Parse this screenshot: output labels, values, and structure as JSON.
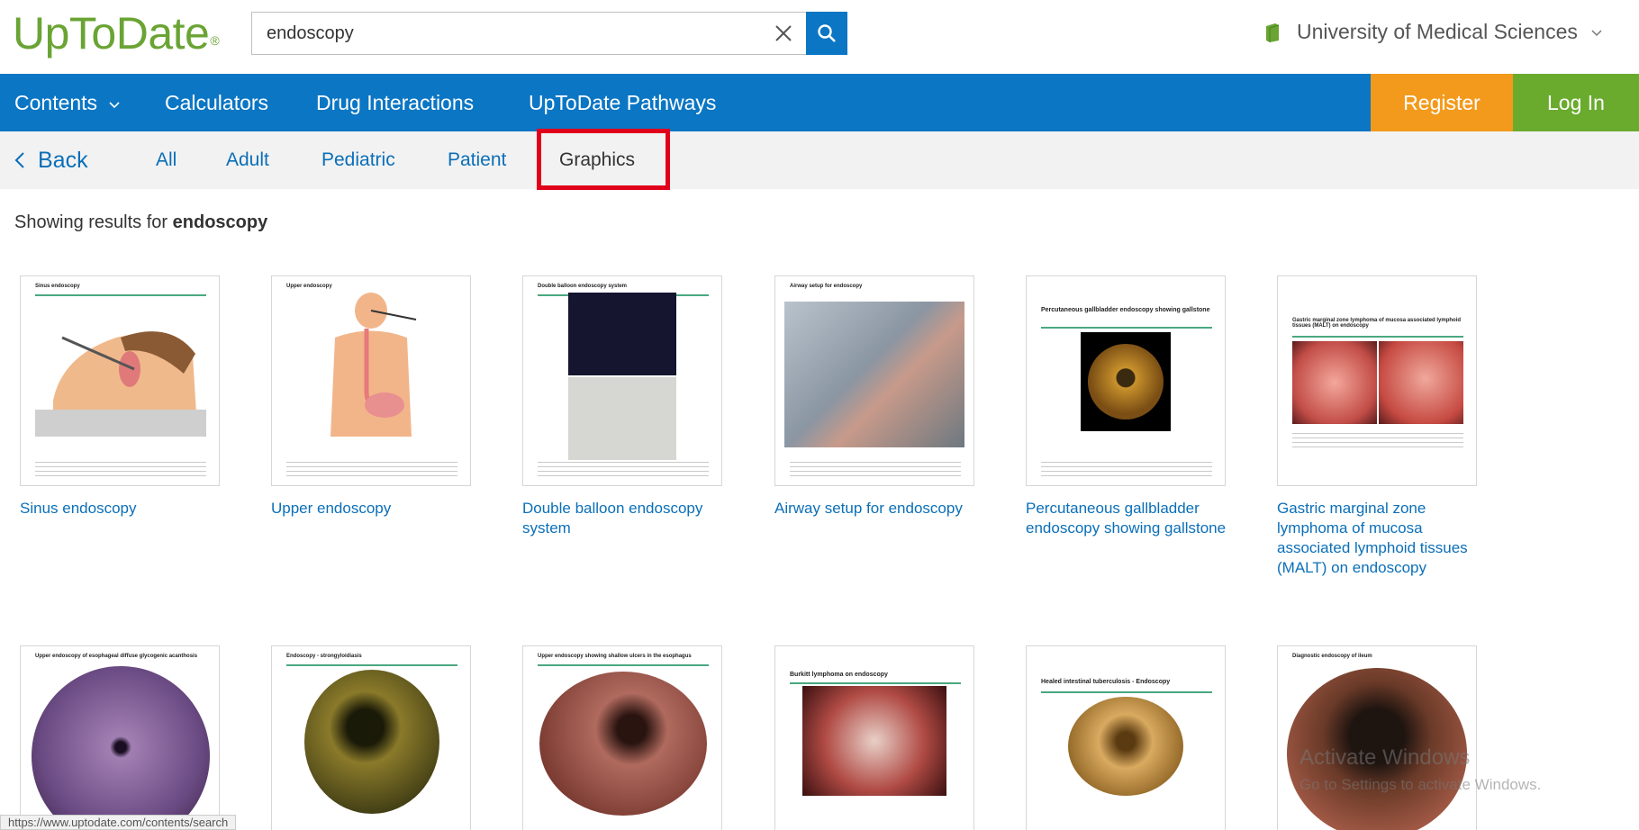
{
  "header": {
    "logo": "UpToDate",
    "logo_mark": "®",
    "search_value": "endoscopy",
    "institution": "University of Medical Sciences"
  },
  "nav": {
    "contents": "Contents",
    "calculators": "Calculators",
    "drug_interactions": "Drug Interactions",
    "pathways": "UpToDate Pathways",
    "register": "Register",
    "login": "Log In"
  },
  "subnav": {
    "back": "Back",
    "tabs": [
      "All",
      "Adult",
      "Pediatric",
      "Patient",
      "Graphics"
    ],
    "active_tab": "Graphics"
  },
  "results": {
    "prefix": "Showing results for",
    "query": "endoscopy",
    "row1": [
      {
        "thumb_title": "Sinus endoscopy",
        "label": "Sinus endoscopy"
      },
      {
        "thumb_title": "Upper endoscopy",
        "label": "Upper endoscopy"
      },
      {
        "thumb_title": "Double balloon endoscopy system",
        "label": "Double balloon endoscopy system"
      },
      {
        "thumb_title": "Airway setup for endoscopy",
        "label": "Airway setup for endoscopy"
      },
      {
        "thumb_title": "Percutaneous gallbladder endoscopy showing gallstone",
        "label": "Percutaneous gallbladder endoscopy showing gallstone"
      },
      {
        "thumb_title": "Gastric marginal zone lymphoma of mucosa associated lymphoid tissues (MALT) on endoscopy",
        "label": "Gastric marginal zone lymphoma of mucosa associated lymphoid tissues (MALT) on endoscopy"
      }
    ],
    "row2": [
      {
        "thumb_title": "Upper endoscopy of esophageal diffuse glycogenic acanthosis"
      },
      {
        "thumb_title": "Endoscopy - strongyloidiasis"
      },
      {
        "thumb_title": "Upper endoscopy showing shallow ulcers in the esophagus"
      },
      {
        "thumb_title": "Burkitt lymphoma on endoscopy"
      },
      {
        "thumb_title": "Healed intestinal tuberculosis - Endoscopy"
      },
      {
        "thumb_title": "Diagnostic endoscopy of ileum"
      }
    ]
  },
  "overlay": {
    "activate_title": "Activate Windows",
    "activate_sub": "Go to Settings to activate Windows.",
    "status_url": "https://www.uptodate.com/contents/search"
  },
  "colors": {
    "brand_green": "#6aa434",
    "nav_blue": "#0b76c4",
    "register_orange": "#f39a1c",
    "login_green": "#6aab2e",
    "highlight_red": "#e0001b"
  }
}
